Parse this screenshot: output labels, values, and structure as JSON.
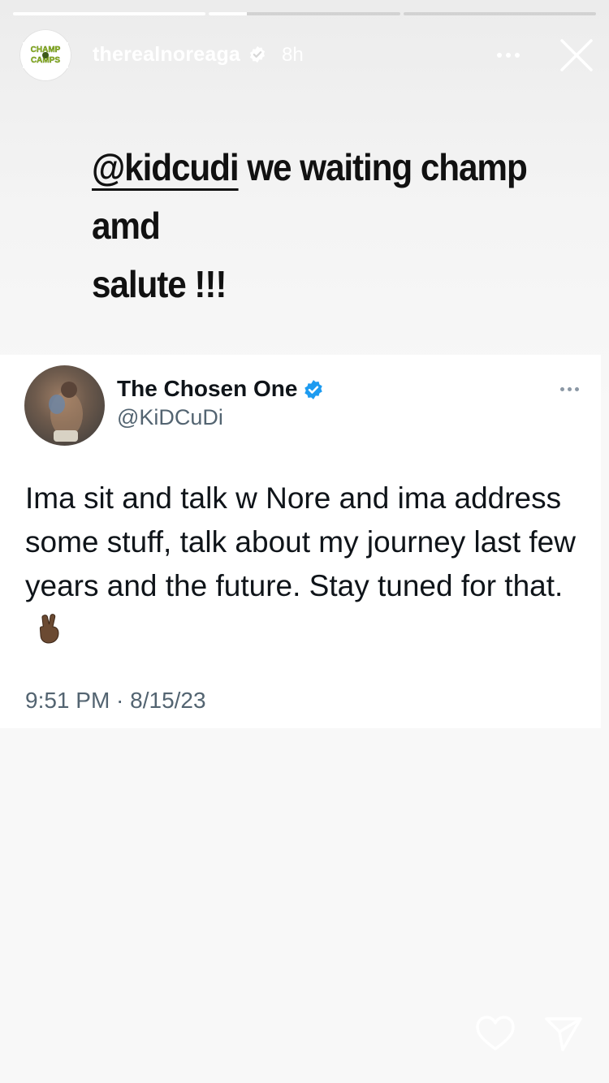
{
  "story": {
    "progress": [
      1.0,
      0.2,
      0.0
    ],
    "username": "therealnoreaga",
    "time": "8h",
    "avatar_text": "CHAMP CAMPS"
  },
  "caption": {
    "mention": "@kidcudi",
    "text_line1": " we waiting champ amd",
    "text_line2": "salute !!!"
  },
  "tweet": {
    "display_name": "The Chosen One",
    "handle": "@KiDCuDi",
    "body": "Ima sit and talk w Nore and ima address some stuff, talk about my journey last few years and the future. Stay tuned for that.",
    "emoji": "victory-hand",
    "timestamp": "9:51 PM · 8/15/23"
  },
  "colors": {
    "verified_blue": "#1d9bf0",
    "text_primary": "#0f1419",
    "text_secondary": "#536471"
  },
  "icons": [
    "verified-badge-icon",
    "more-options-icon",
    "close-icon",
    "heart-icon",
    "send-icon"
  ]
}
